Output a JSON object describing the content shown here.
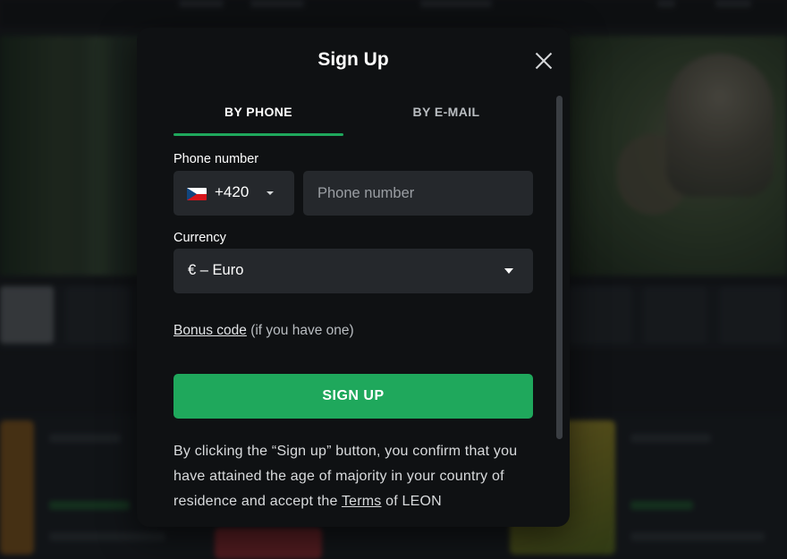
{
  "modal": {
    "title": "Sign Up",
    "tabs": [
      {
        "label": "BY PHONE",
        "active": true
      },
      {
        "label": "BY E-MAIL",
        "active": false
      }
    ],
    "phone": {
      "label": "Phone number",
      "country_code": "+420",
      "country_flag": "czech-flag-icon",
      "placeholder": "Phone number",
      "value": ""
    },
    "currency": {
      "label": "Currency",
      "selected": "€ – Euro"
    },
    "bonus": {
      "link_text": "Bonus code",
      "note": "(if you have one)"
    },
    "signup_button": "SIGN UP",
    "disclaimer": {
      "text": "By clicking the “Sign up” button, you confirm that you have attained the age of majority in your country of residence and accept the",
      "terms_link": "Terms",
      "suffix": "of LEON"
    }
  },
  "colors": {
    "accent": "#1fa85c",
    "modal_bg": "#0f1113",
    "field_bg": "#25282c"
  }
}
